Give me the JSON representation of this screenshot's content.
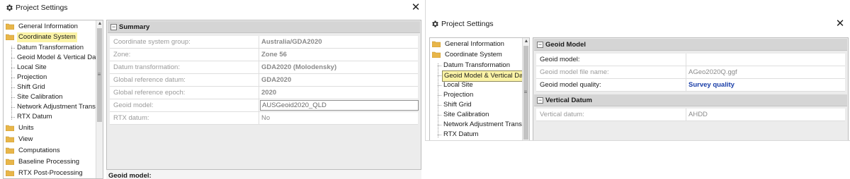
{
  "left_dialog": {
    "title": "Project Settings",
    "close": "✕",
    "tree": {
      "items": [
        {
          "kind": "top",
          "label": "General Information",
          "selected": false
        },
        {
          "kind": "top",
          "label": "Coordinate System",
          "selected": true
        },
        {
          "kind": "child",
          "label": "Datum Transformation"
        },
        {
          "kind": "child",
          "label": "Geoid Model & Vertical Da"
        },
        {
          "kind": "child",
          "label": "Local Site"
        },
        {
          "kind": "child",
          "label": "Projection"
        },
        {
          "kind": "child",
          "label": "Shift Grid"
        },
        {
          "kind": "child",
          "label": "Site Calibration"
        },
        {
          "kind": "child",
          "label": "Network Adjustment Transf"
        },
        {
          "kind": "child",
          "label": "RTX Datum"
        },
        {
          "kind": "top",
          "label": "Units"
        },
        {
          "kind": "top",
          "label": "View"
        },
        {
          "kind": "top",
          "label": "Computations"
        },
        {
          "kind": "top",
          "label": "Baseline Processing"
        },
        {
          "kind": "top",
          "label": "RTX Post-Processing"
        }
      ]
    },
    "summary": {
      "header": "Summary",
      "rows": [
        {
          "name": "Coordinate system group:",
          "value": "Australia/GDA2020",
          "bold": true
        },
        {
          "name": "Zone:",
          "value": "Zone 56",
          "bold": true
        },
        {
          "name": "Datum transformation:",
          "value": "GDA2020  (Molodensky)",
          "bold": true
        },
        {
          "name": "Global reference datum:",
          "value": "GDA2020",
          "bold": true
        },
        {
          "name": "Global reference epoch:",
          "value": "2020",
          "bold": true
        },
        {
          "name": "Geoid model:",
          "value": "AUSGeoid2020_QLD",
          "bold": false,
          "boxed": true
        },
        {
          "name": "RTX datum:",
          "value": "No",
          "bold": false
        }
      ]
    },
    "description_title": "Geoid model:"
  },
  "right_dialog": {
    "title": "Project Settings",
    "close": "✕",
    "tree": {
      "items": [
        {
          "kind": "top",
          "label": "General Information"
        },
        {
          "kind": "top",
          "label": "Coordinate System"
        },
        {
          "kind": "child",
          "label": "Datum Transformation"
        },
        {
          "kind": "child",
          "label": "Geoid Model & Vertical Da",
          "selected": true
        },
        {
          "kind": "child",
          "label": "Local Site"
        },
        {
          "kind": "child",
          "label": "Projection"
        },
        {
          "kind": "child",
          "label": "Shift Grid"
        },
        {
          "kind": "child",
          "label": "Site Calibration"
        },
        {
          "kind": "child",
          "label": "Network Adjustment Transf"
        },
        {
          "kind": "child",
          "label": "RTX Datum"
        }
      ]
    },
    "geoid": {
      "header": "Geoid Model",
      "rows": [
        {
          "name": "Geoid model:",
          "value": ""
        },
        {
          "name": "Geoid model file name:",
          "value": "AGeo2020Q.ggf"
        },
        {
          "name": "Geoid model quality:",
          "value": "Survey quality"
        }
      ]
    },
    "vertical": {
      "header": "Vertical Datum",
      "rows": [
        {
          "name": "Vertical datum:",
          "value": "AHDD"
        }
      ]
    }
  },
  "colors": {
    "selection": "#fbf3a6",
    "folder": "#e8b64a",
    "panel": "#ececec",
    "section_header": "#d5d5d5",
    "quality_value": "#1a3ea8"
  }
}
